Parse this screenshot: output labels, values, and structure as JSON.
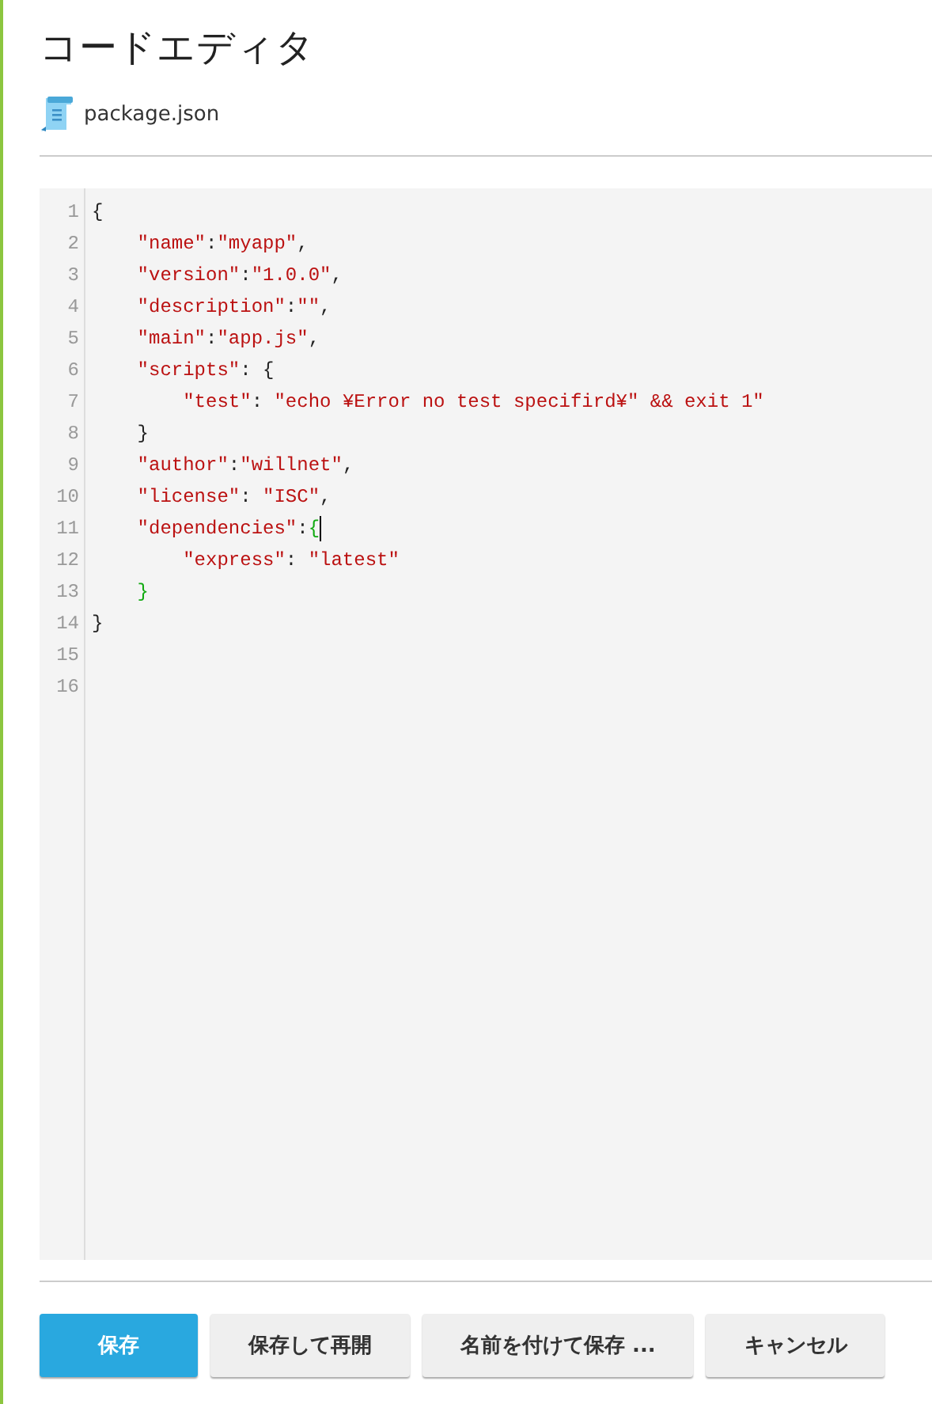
{
  "title": "コードエディタ",
  "file": {
    "name": "package.json"
  },
  "editor": {
    "lines": [
      {
        "number": "1",
        "cursor": false,
        "tokens": [
          {
            "kind": "punct",
            "text": "{"
          }
        ]
      },
      {
        "number": "2",
        "cursor": false,
        "tokens": [
          {
            "kind": "string",
            "text": "    \"name\""
          },
          {
            "kind": "punct",
            "text": ":"
          },
          {
            "kind": "string",
            "text": "\"myapp\""
          },
          {
            "kind": "punct",
            "text": ","
          }
        ]
      },
      {
        "number": "3",
        "cursor": false,
        "tokens": [
          {
            "kind": "string",
            "text": "    \"version\""
          },
          {
            "kind": "punct",
            "text": ":"
          },
          {
            "kind": "string",
            "text": "\"1.0.0\""
          },
          {
            "kind": "punct",
            "text": ","
          }
        ]
      },
      {
        "number": "4",
        "cursor": false,
        "tokens": [
          {
            "kind": "string",
            "text": "    \"description\""
          },
          {
            "kind": "punct",
            "text": ":"
          },
          {
            "kind": "string",
            "text": "\"\""
          },
          {
            "kind": "punct",
            "text": ","
          }
        ]
      },
      {
        "number": "5",
        "cursor": false,
        "tokens": [
          {
            "kind": "string",
            "text": "    \"main\""
          },
          {
            "kind": "punct",
            "text": ":"
          },
          {
            "kind": "string",
            "text": "\"app.js\""
          },
          {
            "kind": "punct",
            "text": ","
          }
        ]
      },
      {
        "number": "6",
        "cursor": false,
        "tokens": [
          {
            "kind": "string",
            "text": "    \"scripts\""
          },
          {
            "kind": "punct",
            "text": ": {"
          }
        ]
      },
      {
        "number": "7",
        "cursor": false,
        "tokens": [
          {
            "kind": "string",
            "text": "        \"test\""
          },
          {
            "kind": "punct",
            "text": ": "
          },
          {
            "kind": "string",
            "text": "\"echo ¥Error no test specifird¥\" && exit 1\""
          }
        ]
      },
      {
        "number": "8",
        "cursor": false,
        "tokens": [
          {
            "kind": "punct",
            "text": "    }"
          }
        ]
      },
      {
        "number": "9",
        "cursor": false,
        "tokens": [
          {
            "kind": "string",
            "text": "    \"author\""
          },
          {
            "kind": "punct",
            "text": ":"
          },
          {
            "kind": "string",
            "text": "\"willnet\""
          },
          {
            "kind": "punct",
            "text": ","
          }
        ]
      },
      {
        "number": "10",
        "cursor": false,
        "tokens": [
          {
            "kind": "string",
            "text": "    \"license\""
          },
          {
            "kind": "punct",
            "text": ": "
          },
          {
            "kind": "string",
            "text": "\"ISC\""
          },
          {
            "kind": "punct",
            "text": ","
          }
        ]
      },
      {
        "number": "11",
        "cursor": true,
        "tokens": [
          {
            "kind": "string",
            "text": "    \"dependencies\""
          },
          {
            "kind": "punct",
            "text": ":"
          },
          {
            "kind": "bracket",
            "text": "{"
          }
        ]
      },
      {
        "number": "12",
        "cursor": false,
        "tokens": [
          {
            "kind": "string",
            "text": "        \"express\""
          },
          {
            "kind": "punct",
            "text": ": "
          },
          {
            "kind": "string",
            "text": "\"latest\""
          }
        ]
      },
      {
        "number": "13",
        "cursor": false,
        "tokens": [
          {
            "kind": "bracket",
            "text": "    }"
          }
        ]
      },
      {
        "number": "14",
        "cursor": false,
        "tokens": [
          {
            "kind": "punct",
            "text": "}"
          }
        ]
      },
      {
        "number": "15",
        "cursor": false
      },
      {
        "number": "16",
        "cursor": false
      }
    ]
  },
  "buttons": [
    {
      "label": "保存",
      "kind": "primary"
    },
    {
      "label": "保存して再開",
      "kind": "default"
    },
    {
      "label": "名前を付けて保存 ...",
      "kind": "default"
    },
    {
      "label": "キャンセル",
      "kind": "default"
    }
  ]
}
